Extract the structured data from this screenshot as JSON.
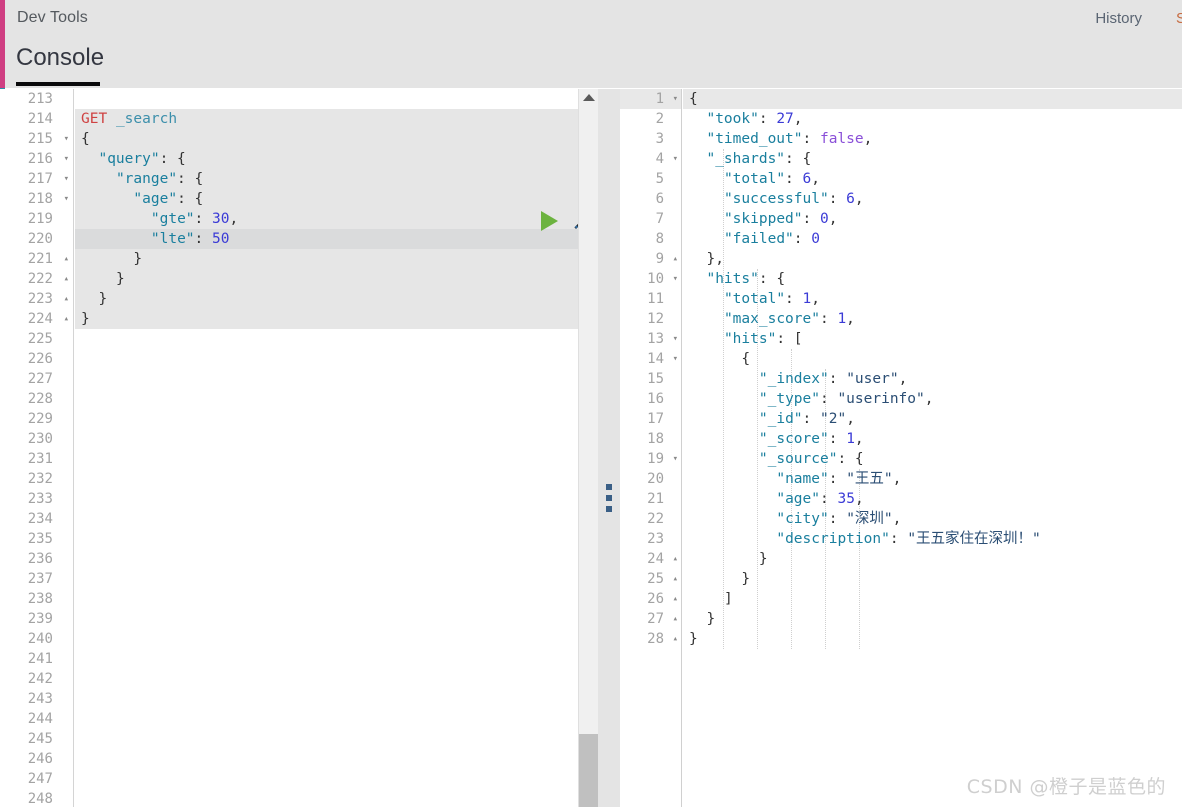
{
  "header": {
    "app_title": "Dev Tools",
    "history_label": "History",
    "settings_label": "S",
    "accent_color": "#cf3e82"
  },
  "tabs": {
    "active": "Console",
    "items": [
      {
        "label": "Console"
      }
    ]
  },
  "request_editor": {
    "first_line_number": 213,
    "last_line_number": 248,
    "active_line": 220,
    "method": "GET",
    "path": "_search",
    "run_label": "play-icon",
    "wrench_label": "wrench-icon",
    "lines": [
      {
        "n": 213,
        "fold": "",
        "text": ""
      },
      {
        "n": 214,
        "fold": "",
        "text": "GET _search"
      },
      {
        "n": 215,
        "fold": "▾",
        "text": "{"
      },
      {
        "n": 216,
        "fold": "▾",
        "text": "  \"query\": {"
      },
      {
        "n": 217,
        "fold": "▾",
        "text": "    \"range\": {"
      },
      {
        "n": 218,
        "fold": "▾",
        "text": "      \"age\": {"
      },
      {
        "n": 219,
        "fold": "",
        "text": "        \"gte\": 30,"
      },
      {
        "n": 220,
        "fold": "",
        "text": "        \"lte\": 50"
      },
      {
        "n": 221,
        "fold": "▴",
        "text": "      }"
      },
      {
        "n": 222,
        "fold": "▴",
        "text": "    }"
      },
      {
        "n": 223,
        "fold": "▴",
        "text": "  }"
      },
      {
        "n": 224,
        "fold": "▴",
        "text": "}"
      },
      {
        "n": 225,
        "fold": "",
        "text": ""
      },
      {
        "n": 226,
        "fold": "",
        "text": ""
      },
      {
        "n": 227,
        "fold": "",
        "text": ""
      },
      {
        "n": 228,
        "fold": "",
        "text": ""
      },
      {
        "n": 229,
        "fold": "",
        "text": ""
      },
      {
        "n": 230,
        "fold": "",
        "text": ""
      },
      {
        "n": 231,
        "fold": "",
        "text": ""
      },
      {
        "n": 232,
        "fold": "",
        "text": ""
      },
      {
        "n": 233,
        "fold": "",
        "text": ""
      },
      {
        "n": 234,
        "fold": "",
        "text": ""
      },
      {
        "n": 235,
        "fold": "",
        "text": ""
      },
      {
        "n": 236,
        "fold": "",
        "text": ""
      },
      {
        "n": 237,
        "fold": "",
        "text": ""
      },
      {
        "n": 238,
        "fold": "",
        "text": ""
      },
      {
        "n": 239,
        "fold": "",
        "text": ""
      },
      {
        "n": 240,
        "fold": "",
        "text": ""
      },
      {
        "n": 241,
        "fold": "",
        "text": ""
      },
      {
        "n": 242,
        "fold": "",
        "text": ""
      },
      {
        "n": 243,
        "fold": "",
        "text": ""
      },
      {
        "n": 244,
        "fold": "",
        "text": ""
      },
      {
        "n": 245,
        "fold": "",
        "text": ""
      },
      {
        "n": 246,
        "fold": "",
        "text": ""
      },
      {
        "n": 247,
        "fold": "",
        "text": ""
      },
      {
        "n": 248,
        "fold": "",
        "text": ""
      }
    ],
    "query_body": {
      "query": {
        "range": {
          "age": {
            "gte": 30,
            "lte": 50
          }
        }
      }
    }
  },
  "response_editor": {
    "active_line": 1,
    "lines": [
      {
        "n": 1,
        "fold": "▾",
        "text": "{"
      },
      {
        "n": 2,
        "fold": "",
        "text": "  \"took\": 27,"
      },
      {
        "n": 3,
        "fold": "",
        "text": "  \"timed_out\": false,"
      },
      {
        "n": 4,
        "fold": "▾",
        "text": "  \"_shards\": {"
      },
      {
        "n": 5,
        "fold": "",
        "text": "    \"total\": 6,"
      },
      {
        "n": 6,
        "fold": "",
        "text": "    \"successful\": 6,"
      },
      {
        "n": 7,
        "fold": "",
        "text": "    \"skipped\": 0,"
      },
      {
        "n": 8,
        "fold": "",
        "text": "    \"failed\": 0"
      },
      {
        "n": 9,
        "fold": "▴",
        "text": "  },"
      },
      {
        "n": 10,
        "fold": "▾",
        "text": "  \"hits\": {"
      },
      {
        "n": 11,
        "fold": "",
        "text": "    \"total\": 1,"
      },
      {
        "n": 12,
        "fold": "",
        "text": "    \"max_score\": 1,"
      },
      {
        "n": 13,
        "fold": "▾",
        "text": "    \"hits\": ["
      },
      {
        "n": 14,
        "fold": "▾",
        "text": "      {"
      },
      {
        "n": 15,
        "fold": "",
        "text": "        \"_index\": \"user\","
      },
      {
        "n": 16,
        "fold": "",
        "text": "        \"_type\": \"userinfo\","
      },
      {
        "n": 17,
        "fold": "",
        "text": "        \"_id\": \"2\","
      },
      {
        "n": 18,
        "fold": "",
        "text": "        \"_score\": 1,"
      },
      {
        "n": 19,
        "fold": "▾",
        "text": "        \"_source\": {"
      },
      {
        "n": 20,
        "fold": "",
        "text": "          \"name\": \"王五\","
      },
      {
        "n": 21,
        "fold": "",
        "text": "          \"age\": 35,"
      },
      {
        "n": 22,
        "fold": "",
        "text": "          \"city\": \"深圳\","
      },
      {
        "n": 23,
        "fold": "",
        "text": "          \"description\": \"王五家住在深圳！\""
      },
      {
        "n": 24,
        "fold": "▴",
        "text": "        }"
      },
      {
        "n": 25,
        "fold": "▴",
        "text": "      }"
      },
      {
        "n": 26,
        "fold": "▴",
        "text": "    ]"
      },
      {
        "n": 27,
        "fold": "▴",
        "text": "  }"
      },
      {
        "n": 28,
        "fold": "▴",
        "text": "}"
      }
    ],
    "values": {
      "took": 27,
      "timed_out": "false",
      "shards": {
        "total": 6,
        "successful": 6,
        "skipped": 0,
        "failed": 0
      },
      "hits_total": 1,
      "max_score": 1,
      "hit": {
        "_index": "user",
        "_type": "userinfo",
        "_id": "2",
        "_score": 1,
        "_source": {
          "name": "王五",
          "age": 35,
          "city": "深圳",
          "description": "王五家住在深圳！"
        }
      }
    }
  },
  "scrollbar": {
    "position": "bottom"
  },
  "watermark": {
    "text": "CSDN @橙子是蓝色的"
  }
}
